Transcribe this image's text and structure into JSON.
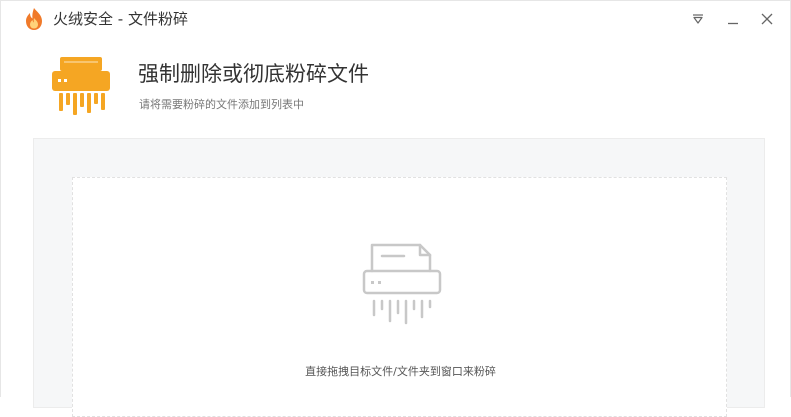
{
  "window": {
    "title": "火绒安全 - 文件粉碎"
  },
  "icons": {
    "app_logo": "huorong-flame-icon",
    "minimize_to_tray": "triangle-down-icon",
    "minimize": "minimize-icon",
    "close": "close-icon",
    "hero": "shredder-icon",
    "drop": "shredder-outline-icon"
  },
  "header": {
    "heading": "强制删除或彻底粉碎文件",
    "subheading": "请将需要粉碎的文件添加到列表中"
  },
  "drop_zone": {
    "hint": "直接拖拽目标文件/文件夹到窗口来粉碎"
  },
  "colors": {
    "accent": "#f5a623",
    "logo": "#f07a2a",
    "drop_icon": "#c8c8c8"
  }
}
